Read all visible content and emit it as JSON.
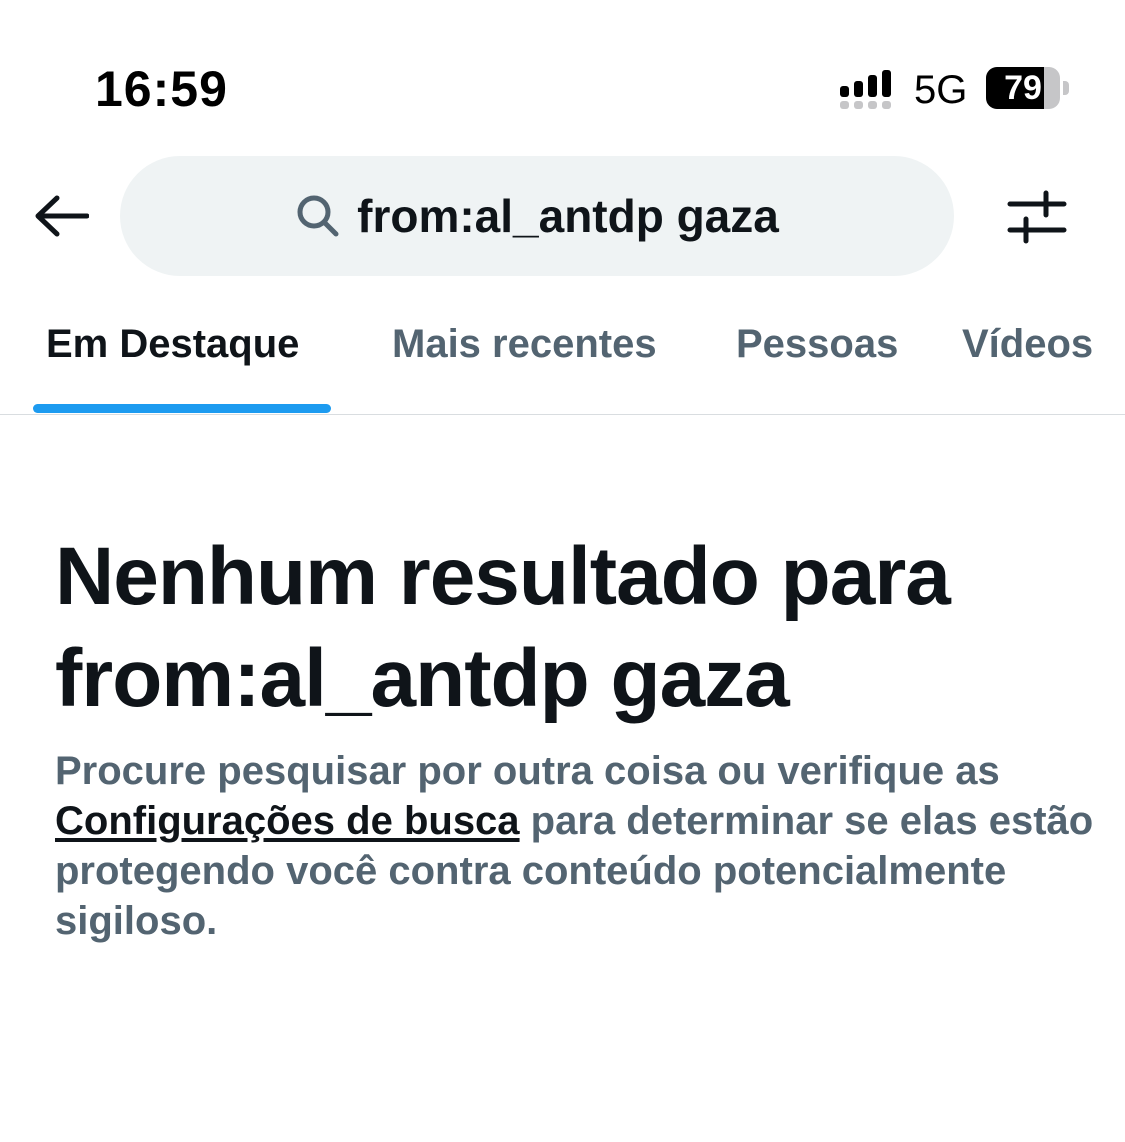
{
  "status_bar": {
    "time": "16:59",
    "network": "5G",
    "battery_level": "79",
    "battery_fraction": 0.79
  },
  "header": {
    "back_icon": "arrow-left-icon",
    "search_icon": "search-icon",
    "search_query": "from:al_antdp gaza",
    "filter_icon": "sliders-icon"
  },
  "tabs": [
    {
      "label": "Em Destaque",
      "active": true
    },
    {
      "label": "Mais recentes",
      "active": false
    },
    {
      "label": "Pessoas",
      "active": false
    },
    {
      "label": "Vídeos",
      "active": false
    }
  ],
  "empty_state": {
    "title_prefix": "Nenhum resultado para",
    "title_query": "from:al_antdp gaza",
    "message_before": "Procure pesquisar por outra coisa ou verifique as ",
    "settings_link": "Configurações de busca",
    "message_after": " para determinar se elas estão protegendo você contra conteúdo potencialmente sigiloso."
  },
  "colors": {
    "accent": "#1d9bf0",
    "primary_text": "#0f1419",
    "secondary_text": "#536471",
    "search_background": "#eff3f4"
  }
}
